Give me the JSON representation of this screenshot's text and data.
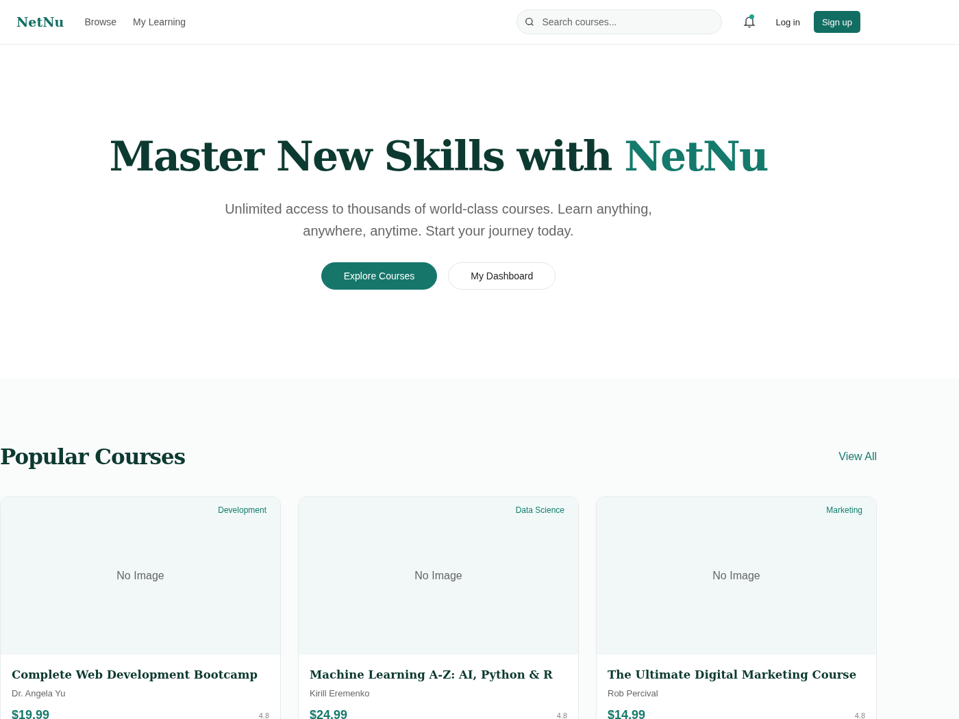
{
  "header": {
    "logo": "NetNu",
    "nav": [
      {
        "label": "Browse"
      },
      {
        "label": "My Learning"
      }
    ],
    "search": {
      "placeholder": "Search courses..."
    },
    "notifications": {
      "unread": true
    },
    "login": "Log in",
    "signup": "Sign up"
  },
  "hero": {
    "title": "Master New Skills with",
    "title_brand": "NetNu",
    "subtitle": "Unlimited access to thousands of world-class courses. Learn anything, anywhere, anytime. Start your journey today.",
    "buttons": [
      {
        "label": "Explore Courses",
        "kind": "primary"
      },
      {
        "label": "My Dashboard",
        "kind": "secondary"
      }
    ]
  },
  "popular": {
    "title": "Popular Courses",
    "view_all": "View All",
    "courses": [
      {
        "category": "Development",
        "image": "No Image",
        "title": "Complete Web Development Bootcamp",
        "instructor": "Dr. Angela Yu",
        "price": "$19.99",
        "rating": "4.8"
      },
      {
        "category": "Data Science",
        "image": "No Image",
        "title": "Machine Learning A-Z: AI, Python & R",
        "instructor": "Kirill Eremenko",
        "price": "$24.99",
        "rating": "4.8"
      },
      {
        "category": "Marketing",
        "image": "No Image",
        "title": "The Ultimate Digital Marketing Course",
        "instructor": "Rob Percival",
        "price": "$14.99",
        "rating": "4.8"
      }
    ]
  }
}
